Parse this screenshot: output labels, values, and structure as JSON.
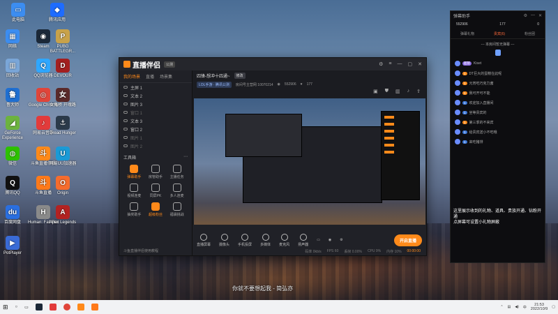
{
  "desktop": {
    "icons": [
      {
        "label": "此电脑",
        "name": "this-pc-icon",
        "color": "#3c8df0",
        "glyph": "▭"
      },
      {
        "label": "腾讯应用",
        "name": "tencent-app-icon",
        "color": "#1e6cff",
        "glyph": "◆"
      },
      {
        "label": "网络",
        "name": "network-icon",
        "color": "#3c8df0",
        "glyph": "▦"
      },
      {
        "label": "Steam",
        "name": "steam-icon",
        "color": "#1b2838",
        "glyph": "◉"
      },
      {
        "label": "PUBG BATTLEGR...",
        "name": "pubg-icon",
        "color": "#c8a24a",
        "glyph": "P"
      },
      {
        "label": "回收站",
        "name": "recycle-bin-icon",
        "color": "#7aa6d8",
        "glyph": "▥"
      },
      {
        "label": "QQ浏览器",
        "name": "qq-browser-icon",
        "color": "#2fa7ff",
        "glyph": "Q"
      },
      {
        "label": "DEVOUR",
        "name": "devour-icon",
        "color": "#a31f1f",
        "glyph": "D"
      },
      {
        "label": "鲁大师",
        "name": "ludashi-icon",
        "color": "#1f6fd1",
        "glyph": "鲁"
      },
      {
        "label": "Google Chrome",
        "name": "chrome-icon",
        "color": "#e0453a",
        "glyph": "◎"
      },
      {
        "label": "女鬼桥 开魂路",
        "name": "nvguiqiao-icon",
        "color": "#5a2a2a",
        "glyph": "女"
      },
      {
        "label": "GeForce Experience",
        "name": "geforce-icon",
        "color": "#6cb33f",
        "glyph": "◢"
      },
      {
        "label": "网易云音乐",
        "name": "netease-music-icon",
        "color": "#e23b3b",
        "glyph": "♪"
      },
      {
        "label": "Dread Hunger",
        "name": "dread-hunger-icon",
        "color": "#2b3a4a",
        "glyph": "⚓"
      },
      {
        "label": "微信",
        "name": "wechat-icon",
        "color": "#2dc100",
        "glyph": "◍"
      },
      {
        "label": "斗鱼直播伴侣",
        "name": "douyu-companion-icon",
        "color": "#ff8a1a",
        "glyph": "斗"
      },
      {
        "label": "网易UU加速器",
        "name": "uu-accelerator-icon",
        "color": "#1b9ad6",
        "glyph": "U"
      },
      {
        "label": "腾讯QQ",
        "name": "tencent-qq-icon",
        "color": "#111111",
        "glyph": "Q"
      },
      {
        "label": "斗鱼直播",
        "name": "douyu-live-icon",
        "color": "#ff7a1a",
        "glyph": "斗"
      },
      {
        "label": "Origin",
        "name": "origin-icon",
        "color": "#f56c2d",
        "glyph": "O"
      },
      {
        "label": "百度网盘",
        "name": "baidu-netdisk-icon",
        "color": "#2a6fe0",
        "glyph": "du"
      },
      {
        "label": "Human: Fall Flat",
        "name": "human-fall-flat-icon",
        "color": "#8a8a8a",
        "glyph": "H"
      },
      {
        "label": "Apex Legends",
        "name": "apex-icon",
        "color": "#b22222",
        "glyph": "A"
      },
      {
        "label": "PotPlayer",
        "name": "potplayer-icon",
        "color": "#3a6bd6",
        "glyph": "▶"
      }
    ]
  },
  "app": {
    "title": "直播伴侣",
    "tag": "公测",
    "left_tabs": [
      "我的场景",
      "直播",
      "场景集"
    ],
    "scenes": [
      {
        "label": "主屏 1",
        "dim": false
      },
      {
        "label": "文本 2",
        "dim": false
      },
      {
        "label": "图片 3",
        "dim": false
      },
      {
        "label": "窗口 1",
        "dim": true
      },
      {
        "label": "文本 3",
        "dim": false
      },
      {
        "label": "窗口 2",
        "dim": false
      },
      {
        "label": "图片 1",
        "dim": true
      },
      {
        "label": "图片 2",
        "dim": true
      }
    ],
    "tools_title": "工具箱",
    "tools": [
      {
        "label": "弹幕助手",
        "orange": true
      },
      {
        "label": "房管助手",
        "orange": false
      },
      {
        "label": "主播任务",
        "orange": false
      },
      {
        "label": "视频连麦",
        "orange": false
      },
      {
        "label": "同屏PK",
        "orange": false
      },
      {
        "label": "多人连麦",
        "orange": false
      },
      {
        "label": "抽奖助手",
        "orange": false
      },
      {
        "label": "超级粉丝",
        "orange": true
      },
      {
        "label": "福袋挑战",
        "orange": false
      }
    ],
    "left_footer": "斗鱼直播伴侣使用教程",
    "room_title": "四锋-想冲十四通~",
    "room_badge": "修改",
    "room_category": "LOL手游 · 腾讯公测",
    "room_id": "房间号主营网 10070214",
    "room_viewers": "552906",
    "room_followers": "177",
    "bottom_items": [
      "直播屏幕",
      "摄像头",
      "手机投屏",
      "多媒体",
      "麦克风",
      "扬声器"
    ],
    "start_live": "开启直播",
    "status": {
      "bitrate": "码率 0kb/s",
      "fps": "FPS 60",
      "dropped": "丢帧 0.00%",
      "cpu": "CPU 9%",
      "mem": "内存 10%",
      "time": "00:00:00"
    }
  },
  "chat": {
    "title": "弹幕助手",
    "stats": [
      "552906",
      "177",
      "0"
    ],
    "tabs": [
      "弹幕礼物",
      "贵宾(6)",
      "粉丝团"
    ],
    "notice": "--- 本房间暂无弹幕 ---",
    "messages": [
      {
        "level": "超管",
        "cls": "purple",
        "text": "Kiset"
      },
      {
        "level": "1",
        "cls": "",
        "text": "DT巨大的蛋糕在此呢"
      },
      {
        "level": "1",
        "cls": "",
        "text": "元宵吃巧克力酱"
      },
      {
        "level": "1",
        "cls": "",
        "text": "我可开可不能"
      },
      {
        "level": "1",
        "cls": "blue",
        "text": "欢迎加入直播间"
      },
      {
        "level": "1",
        "cls": "blue",
        "text": "坐等贵宾的"
      },
      {
        "level": "1",
        "cls": "",
        "text": "第三季的不来宾"
      },
      {
        "level": "1",
        "cls": "blue",
        "text": "给贵宾送小不吃哦"
      },
      {
        "level": "1",
        "cls": "blue",
        "text": "来吃猪排"
      }
    ],
    "footer": "这里展示收到的礼物、道具、贵族开通、钻粉开通\n点屏幕可设置小礼物屏蔽"
  },
  "subtitle": "你就不要想起我 - 简弘亦",
  "taskbar": {
    "time": "21:53",
    "date": "2022/10/9",
    "lang": "中"
  }
}
